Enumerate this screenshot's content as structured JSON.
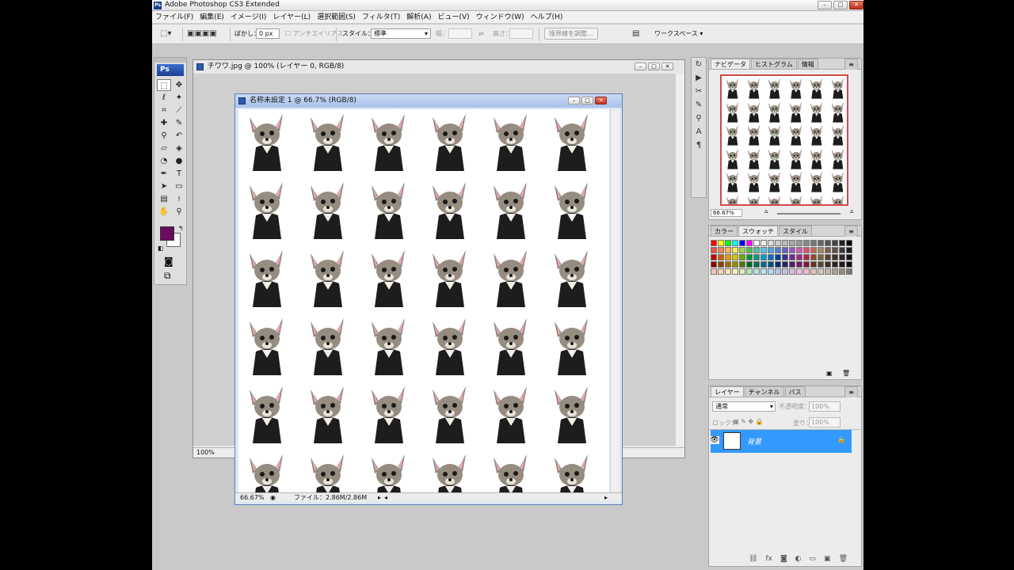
{
  "app": {
    "title": "Adobe Photoshop CS3 Extended",
    "menu": [
      "ファイル(F)",
      "編集(E)",
      "イメージ(I)",
      "レイヤー(L)",
      "選択範囲(S)",
      "フィルタ(T)",
      "解析(A)",
      "ビュー(V)",
      "ウィンドウ(W)",
      "ヘルプ(H)"
    ]
  },
  "options": {
    "feather_label": "ぼかし：",
    "feather_value": "0 px",
    "antialias_label": "アンチエイリアス",
    "style_label": "スタイル：",
    "style_value": "標準",
    "width_label": "幅：",
    "height_label": "高さ：",
    "refine_edge": "境界線を調整...",
    "workspace": "ワークスペース"
  },
  "toolbox": {
    "logo": "Ps",
    "fg_color": "#6b0b5e",
    "bg_color": "#ffffff"
  },
  "doc_back": {
    "title": "チワワ.jpg @ 100% (レイヤー 0, RGB/8)",
    "zoom": "100%"
  },
  "doc_front": {
    "title": "名称未設定 1 @ 66.7% (RGB/8)",
    "zoom": "66.67%",
    "file_info": "ファイル：2.86M/2.86M"
  },
  "navigator": {
    "tabs": [
      "ナビゲータ",
      "ヒストグラム",
      "情報"
    ],
    "zoom": "66.67%"
  },
  "color_panel": {
    "tabs": [
      "カラー",
      "スウォッチ",
      "スタイル"
    ]
  },
  "layers_panel": {
    "tabs": [
      "レイヤー",
      "チャンネル",
      "パス"
    ],
    "blend_mode": "通常",
    "opacity_label": "不透明度：",
    "opacity_value": "100%",
    "lock_label": "ロック：",
    "fill_label": "塗り：",
    "fill_value": "100%",
    "layers": [
      {
        "name": "背景",
        "selected": true
      }
    ]
  },
  "accent_colors": {
    "selection": "#3399ff",
    "close_button": "#c2301b"
  }
}
